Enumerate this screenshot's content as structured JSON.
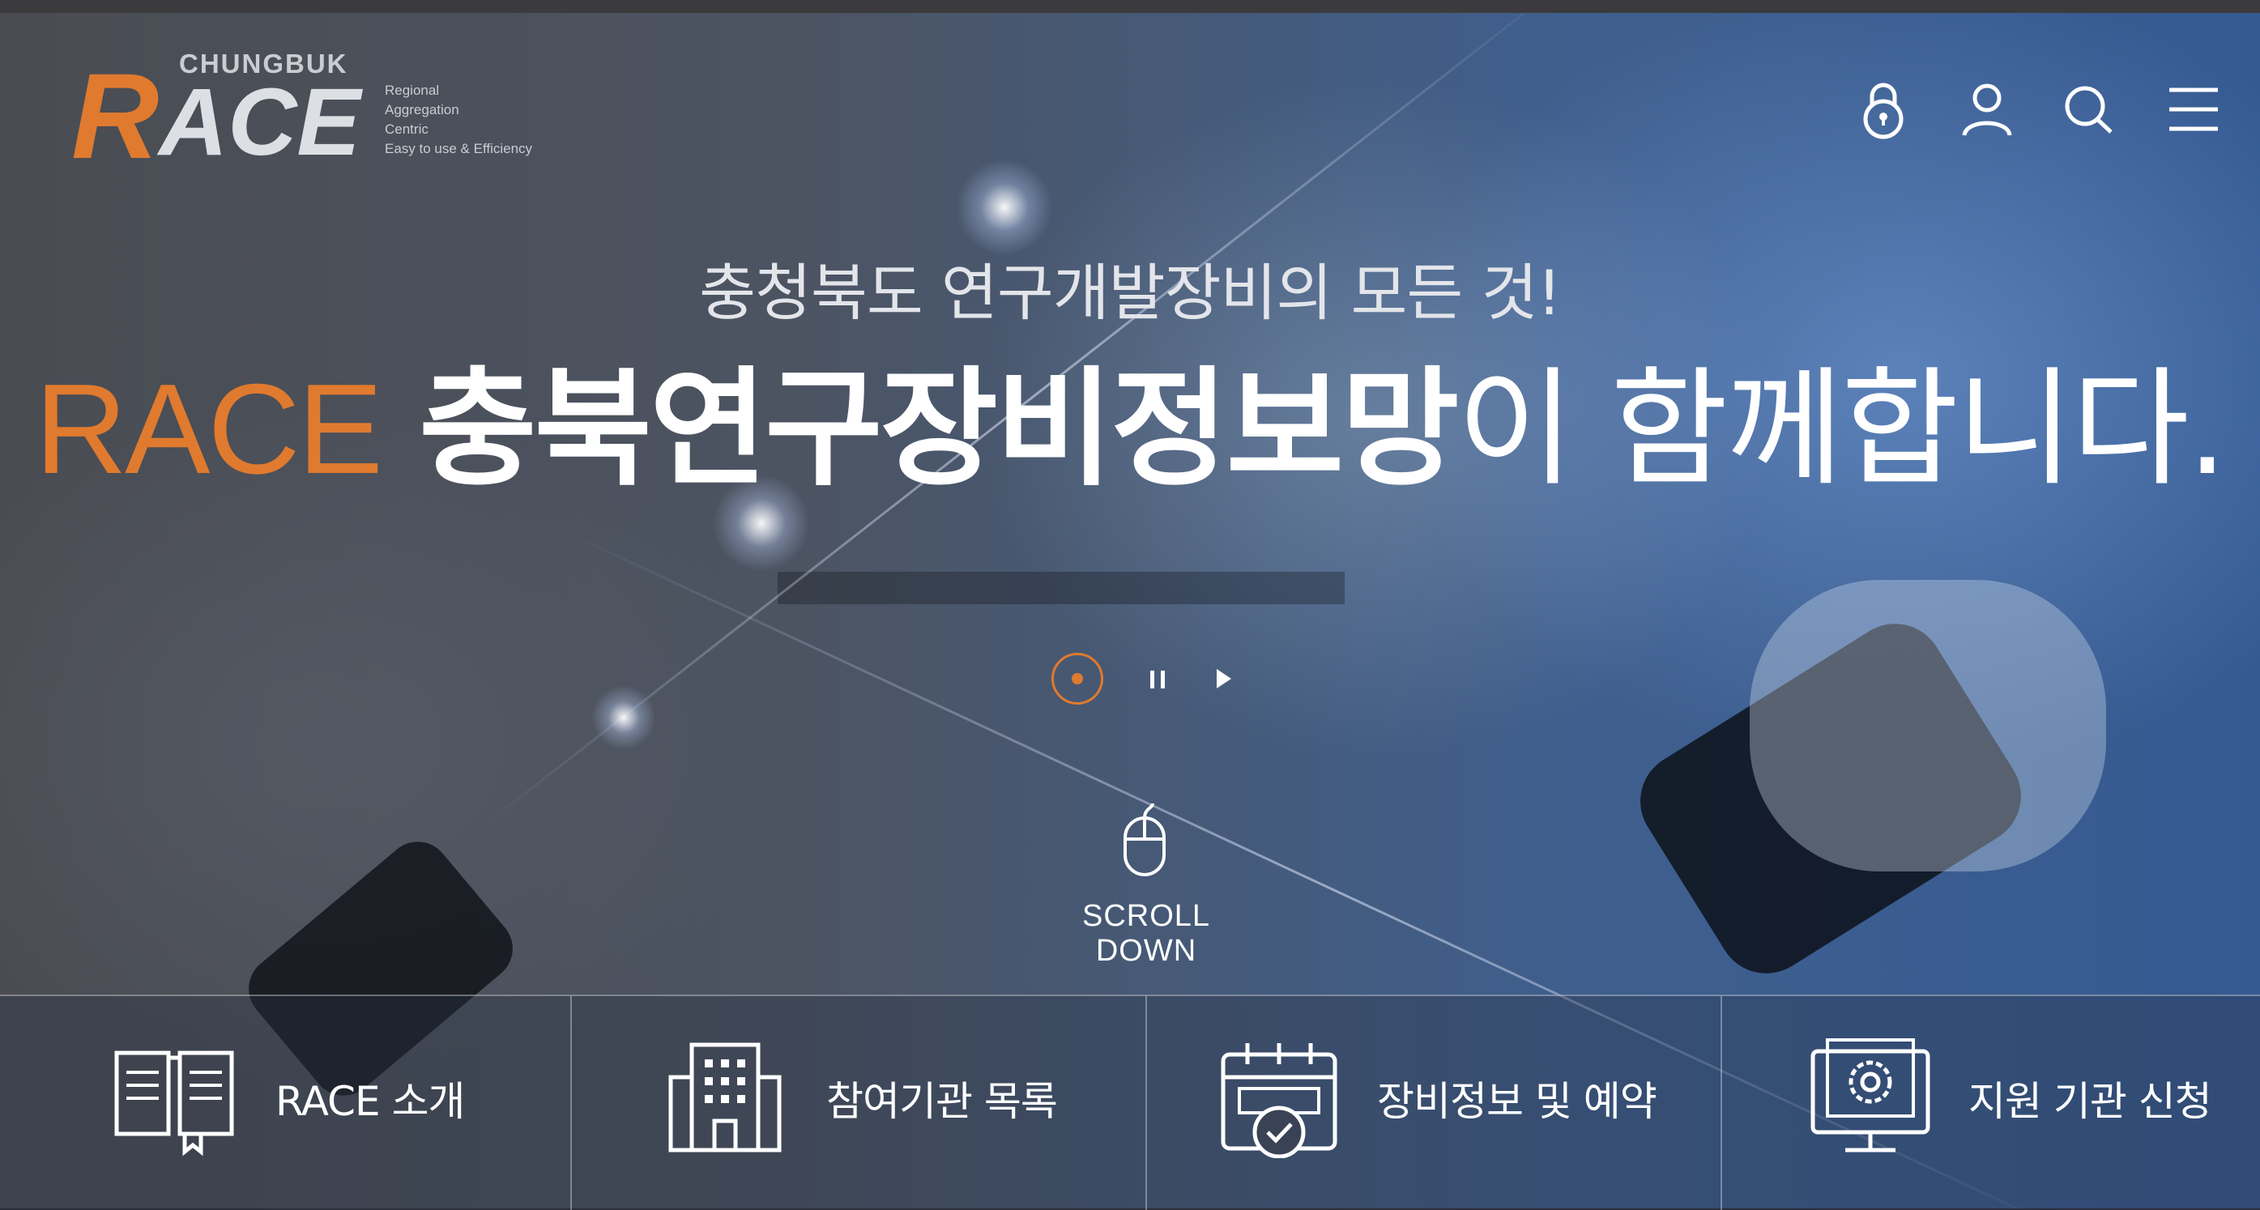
{
  "logo": {
    "region": "CHUNGBUK",
    "letter_r": "R",
    "letters_ace": "ACE",
    "tagline": [
      "Regional",
      "Aggregation",
      "Centric",
      "Easy to use & Efficiency"
    ]
  },
  "nav": {
    "icons": [
      "lock-icon",
      "user-icon",
      "search-icon",
      "menu-icon"
    ]
  },
  "hero": {
    "subtitle": "충청북도 연구개발장비의 모든 것!",
    "headline_brand": "RACE",
    "headline_bold": "충북연구장비정보망",
    "headline_rest": "이 함께합니다."
  },
  "scroll": {
    "label": "SCROLL DOWN"
  },
  "quick_menu": [
    {
      "label": "RACE 소개",
      "icon": "book-icon"
    },
    {
      "label": "참여기관 목록",
      "icon": "building-icon"
    },
    {
      "label": "장비정보 및 예약",
      "icon": "calendar-check-icon"
    },
    {
      "label": "지원 기관 신청",
      "icon": "monitor-gear-icon"
    }
  ],
  "colors": {
    "accent": "#e07a2e",
    "text": "#ffffff"
  }
}
